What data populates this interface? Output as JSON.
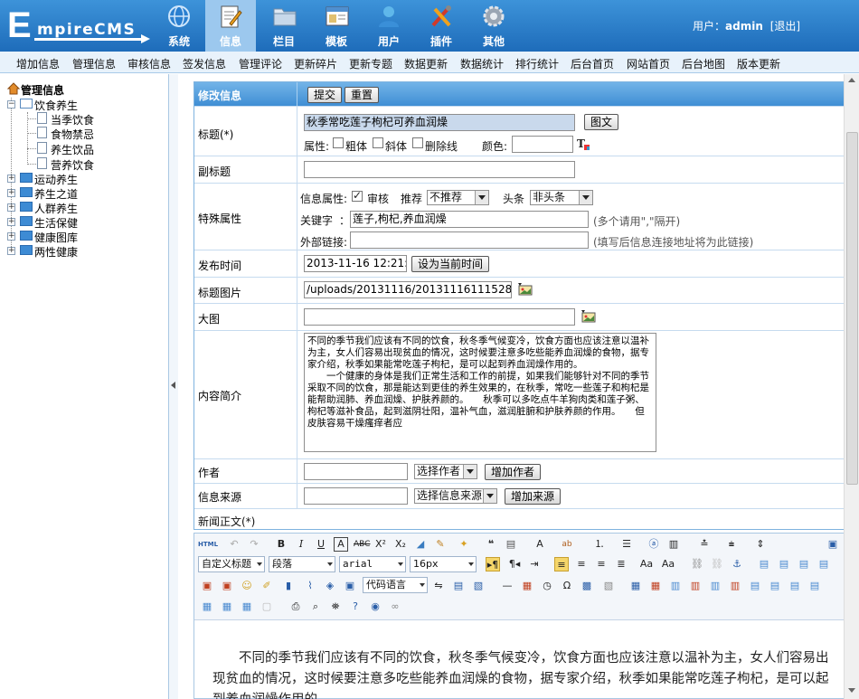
{
  "header": {
    "logo_initial": "E",
    "logo_rest": "mpireCMS",
    "nav": [
      {
        "label": "系统",
        "icon": "globe-icon"
      },
      {
        "label": "信息",
        "icon": "document-edit-icon",
        "active": true
      },
      {
        "label": "栏目",
        "icon": "folder-icon"
      },
      {
        "label": "模板",
        "icon": "window-icon"
      },
      {
        "label": "用户",
        "icon": "user-icon"
      },
      {
        "label": "插件",
        "icon": "tools-icon"
      },
      {
        "label": "其他",
        "icon": "gear-icon"
      }
    ],
    "user_prefix": "用户：",
    "user_name": "admin",
    "logout": "[退出]"
  },
  "menu": [
    "增加信息",
    "管理信息",
    "审核信息",
    "签发信息",
    "管理评论",
    "更新碎片",
    "更新专题",
    "数据更新",
    "数据统计",
    "排行统计",
    "后台首页",
    "网站首页",
    "后台地图",
    "版本更新"
  ],
  "sidebar": {
    "root": "管理信息",
    "expanded": "饮食养生",
    "children": [
      "当季饮食",
      "食物禁忌",
      "养生饮品",
      "营养饮食"
    ],
    "others": [
      "运动养生",
      "养生之道",
      "人群养生",
      "生活保健",
      "健康图库",
      "两性健康"
    ]
  },
  "form": {
    "header_label": "修改信息",
    "submit": "提交",
    "reset": "重置",
    "title_label": "标题(*)",
    "title_value": "秋季常吃莲子枸杞可养血润燥",
    "title_pic_btn": "图文",
    "attr_label": "属性:",
    "attr_bold": "粗体",
    "attr_italic": "斜体",
    "attr_strike": "删除线",
    "color_label": "颜色:",
    "subtitle_label": "副标题",
    "special_label": "特殊属性",
    "info_attr_label": "信息属性:",
    "audit_label": "审核",
    "recommend_label": "推荐",
    "recommend_value": "不推荐",
    "headline_label": "头条",
    "headline_value": "非头条",
    "keywords_label": "关键字",
    "keywords_colon": "：",
    "keywords_value": "莲子,枸杞,养血润燥",
    "keywords_hint": "(多个请用\",\"隔开)",
    "external_label": "外部链接:",
    "external_hint": "(填写后信息连接地址将为此链接)",
    "date_label": "发布时间",
    "date_value": "2013-11-16 12:21:07",
    "date_btn": "设为当前时间",
    "titlepic_label": "标题图片",
    "titlepic_value": "/uploads/20131116/20131116111528122.jp",
    "bigpic_label": "大图",
    "intro_label": "内容简介",
    "intro_text": "不同的季节我们应该有不同的饮食，秋冬季气候变冷，饮食方面也应该注意以温补为主，女人们容易出现贫血的情况，这时候要注意多吃些能养血润燥的食物，据专家介绍，秋季如果能常吃莲子枸杞，是可以起到养血润燥作用的。\n　　一个健康的身体是我们正常生活和工作的前提，如果我们能够针对不同的季节采取不同的饮食，那是能达到更佳的养生效果的，在秋季，常吃一些莲子和枸杞是能帮助润肺、养血润燥、护肤养颜的。　　秋季可以多吃点牛羊狗肉类和莲子粥、枸杞等滋补食品，起到滋阴壮阳，温补气血，滋润脏腑和护肤养颜的作用。　　但皮肤容易干燥瘙痒者应",
    "author_label": "作者",
    "author_select": "选择作者",
    "author_btn": "增加作者",
    "source_label": "信息来源",
    "source_select": "选择信息来源",
    "source_btn": "增加来源",
    "body_label": "新闻正文(*)"
  },
  "editor": {
    "html_btn": "HTML",
    "style_select": "自定义标题",
    "para_select": "段落",
    "font_select": "arial",
    "size_select": "16px",
    "code_select": "代码语言",
    "content": "不同的季节我们应该有不同的饮食，秋冬季气候变冷，饮食方面也应该注意以温补为主，女人们容易出现贫血的情况，这时候要注意多吃些能养血润燥的食物，据专家介绍，秋季如果能常吃莲子枸杞，是可以起到养血润燥作用的。"
  },
  "colors": {
    "header": "#2f80ce",
    "menubar": "#e8f2fb",
    "form_header": "#5aa3e0",
    "border": "#7fb3df"
  }
}
